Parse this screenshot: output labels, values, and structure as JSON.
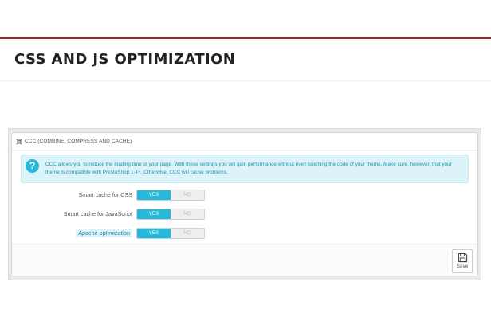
{
  "page": {
    "title": "CSS AND JS OPTIMIZATION"
  },
  "panel": {
    "title": "CCC (COMBINE, COMPRESS AND CACHE)",
    "header_icon": "compress-arrows-icon",
    "alert": {
      "icon": "question-circle-icon",
      "text": "CCC allows you to reduce the loading time of your page. With these settings you will gain performance without even touching the code of your theme. Make sure, however, that your theme is compatible with PrestaShop 1.4+. Otherwise, CCC will cause problems."
    },
    "options": [
      {
        "label": "Smart cache for CSS",
        "yes": "YES",
        "no": "NO",
        "selected": "YES"
      },
      {
        "label": "Smart cache for JavaScript",
        "yes": "YES",
        "no": "NO",
        "selected": "YES"
      },
      {
        "label": "Apache optimization",
        "yes": "YES",
        "no": "NO",
        "selected": "YES"
      }
    ],
    "save": {
      "label": "Save",
      "icon": "floppy-disk-icon"
    }
  },
  "colors": {
    "accent_red": "#a3262b",
    "toggle_active": "#25b9d7",
    "alert_bg": "#dcf4f9",
    "alert_text": "#1e94ab"
  }
}
